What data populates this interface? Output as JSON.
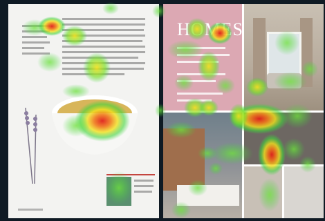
{
  "magazine": {
    "right_title": "HOMES"
  },
  "colors": {
    "background": "#0f1a24",
    "left_page": "#f3f3f1",
    "homes_panel": "#dca8b3",
    "heat_hot": "#e0201a",
    "heat_warm": "#f2e11c",
    "heat_cool": "#3fd43a"
  }
}
